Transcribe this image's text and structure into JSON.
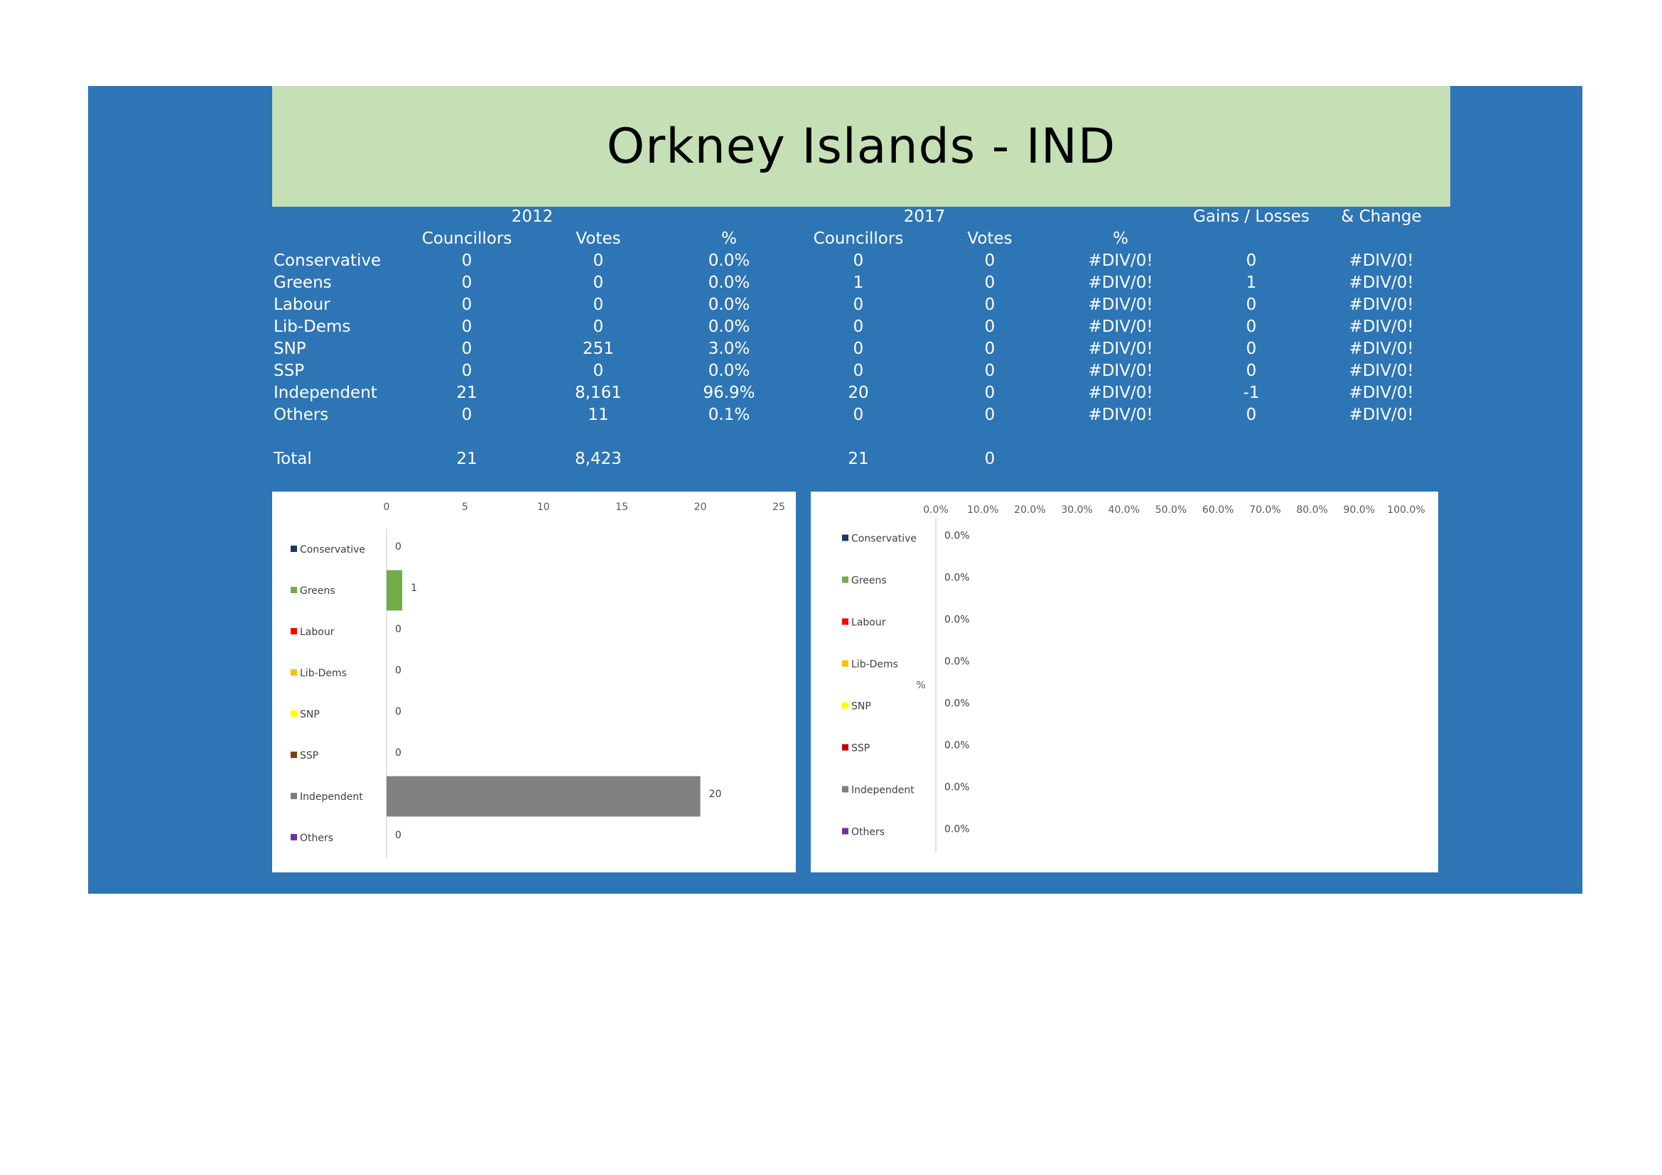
{
  "title": "Orkney Islands - IND",
  "table": {
    "year_2012": "2012",
    "year_2017": "2017",
    "gains_losses_header": "Gains / Losses",
    "change_header": "& Change",
    "col_councillors": "Councillors",
    "col_votes": "Votes",
    "col_pct": "%",
    "rows": [
      {
        "party": "Conservative",
        "c2012": "0",
        "v2012": "0",
        "p2012": "0.0%",
        "c2017": "0",
        "v2017": "0",
        "p2017": "#DIV/0!",
        "gains": "0",
        "change": "#DIV/0!"
      },
      {
        "party": "Greens",
        "c2012": "0",
        "v2012": "0",
        "p2012": "0.0%",
        "c2017": "1",
        "v2017": "0",
        "p2017": "#DIV/0!",
        "gains": "1",
        "change": "#DIV/0!"
      },
      {
        "party": "Labour",
        "c2012": "0",
        "v2012": "0",
        "p2012": "0.0%",
        "c2017": "0",
        "v2017": "0",
        "p2017": "#DIV/0!",
        "gains": "0",
        "change": "#DIV/0!"
      },
      {
        "party": "Lib-Dems",
        "c2012": "0",
        "v2012": "0",
        "p2012": "0.0%",
        "c2017": "0",
        "v2017": "0",
        "p2017": "#DIV/0!",
        "gains": "0",
        "change": "#DIV/0!"
      },
      {
        "party": "SNP",
        "c2012": "0",
        "v2012": "251",
        "p2012": "3.0%",
        "c2017": "0",
        "v2017": "0",
        "p2017": "#DIV/0!",
        "gains": "0",
        "change": "#DIV/0!"
      },
      {
        "party": "SSP",
        "c2012": "0",
        "v2012": "0",
        "p2012": "0.0%",
        "c2017": "0",
        "v2017": "0",
        "p2017": "#DIV/0!",
        "gains": "0",
        "change": "#DIV/0!"
      },
      {
        "party": "Independent",
        "c2012": "21",
        "v2012": "8,161",
        "p2012": "96.9%",
        "c2017": "20",
        "v2017": "0",
        "p2017": "#DIV/0!",
        "gains": "-1",
        "change": "#DIV/0!"
      },
      {
        "party": "Others",
        "c2012": "0",
        "v2012": "11",
        "p2012": "0.1%",
        "c2017": "0",
        "v2017": "0",
        "p2017": "#DIV/0!",
        "gains": "0",
        "change": "#DIV/0!"
      }
    ],
    "total": {
      "label": "Total",
      "c2012": "21",
      "v2012": "8,423",
      "c2017": "21",
      "v2017": "0"
    }
  },
  "chart_data": [
    {
      "type": "bar",
      "orientation": "horizontal",
      "categories": [
        "Conservative",
        "Greens",
        "Labour",
        "Lib-Dems",
        "SNP",
        "SSP",
        "Independent",
        "Others"
      ],
      "values": [
        0,
        1,
        0,
        0,
        0,
        0,
        20,
        0
      ],
      "colors": [
        "#1f3864",
        "#70ad47",
        "#ff0000",
        "#ffc000",
        "#ffff00",
        "#843c0c",
        "#808080",
        "#7030a0"
      ],
      "xlim": [
        0,
        25
      ],
      "xticks": [
        "0",
        "5",
        "10",
        "15",
        "20",
        "25"
      ],
      "axis_position": "top",
      "legend": "left"
    },
    {
      "type": "bar",
      "orientation": "horizontal",
      "categories": [
        "Conservative",
        "Greens",
        "Labour",
        "Lib-Dems",
        "SNP",
        "SSP",
        "Independent",
        "Others"
      ],
      "values": [
        0,
        0,
        0,
        0,
        0,
        0,
        0,
        0
      ],
      "value_labels": [
        "0.0%",
        "0.0%",
        "0.0%",
        "0.0%",
        "0.0%",
        "0.0%",
        "0.0%",
        "0.0%"
      ],
      "colors": [
        "#1f3864",
        "#70ad47",
        "#ff0000",
        "#ffc000",
        "#ffff00",
        "#c00000",
        "#808080",
        "#7030a0"
      ],
      "xlim": [
        0,
        1
      ],
      "xticks": [
        "0.0%",
        "10.0%",
        "20.0%",
        "30.0%",
        "40.0%",
        "50.0%",
        "60.0%",
        "70.0%",
        "80.0%",
        "90.0%",
        "100.0%"
      ],
      "ylabel": "%",
      "axis_position": "top",
      "legend": "left"
    }
  ]
}
